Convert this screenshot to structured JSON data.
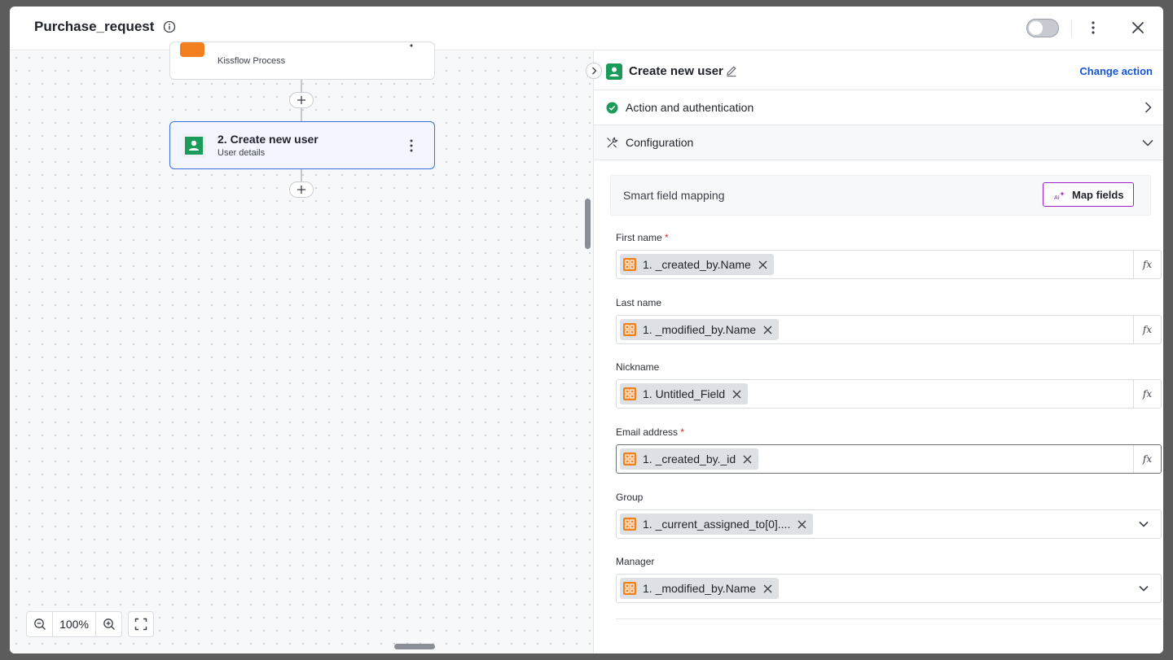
{
  "header": {
    "title": "Purchase_request"
  },
  "canvas": {
    "node1": {
      "subtitle": "Kissflow Process"
    },
    "node2": {
      "title": "2. Create new user",
      "subtitle": "User details"
    },
    "zoom": "100%"
  },
  "panel": {
    "title": "Create new user",
    "change_action": "Change action",
    "sections": {
      "auth": "Action and authentication",
      "config": "Configuration"
    },
    "smart_mapping": {
      "label": "Smart field mapping",
      "button": "Map fields"
    },
    "fields": [
      {
        "label": "First name",
        "required": "*",
        "value": "1. _created_by.Name"
      },
      {
        "label": "Last name",
        "value": "1. _modified_by.Name"
      },
      {
        "label": "Nickname",
        "value": "1. Untitled_Field"
      },
      {
        "label": "Email address",
        "required": "*",
        "value": "1. _created_by._id"
      },
      {
        "label": "Group",
        "value": "1. _current_assigned_to[0]...."
      },
      {
        "label": "Manager",
        "value": "1. _modified_by.Name"
      }
    ],
    "fx_label": "fx"
  },
  "colors": {
    "accent": "#1554d6",
    "green": "#1a9b5a",
    "orange": "#f2801f",
    "purple": "#a020c8",
    "required": "#d12c2c"
  }
}
